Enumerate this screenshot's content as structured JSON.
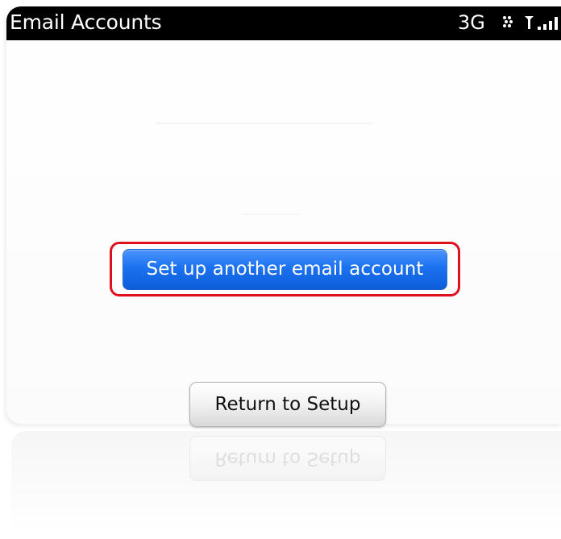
{
  "status_bar": {
    "title": "Email Accounts",
    "network": "3G"
  },
  "icons": {
    "bb_logo": "blackberry-logo-icon",
    "signal": "signal-strength-icon"
  },
  "buttons": {
    "setup_another": "Set up another email account",
    "return_setup": "Return to Setup"
  },
  "colors": {
    "primary_blue": "#1c72ef",
    "highlight_red": "#e0101f",
    "status_black": "#000000"
  }
}
